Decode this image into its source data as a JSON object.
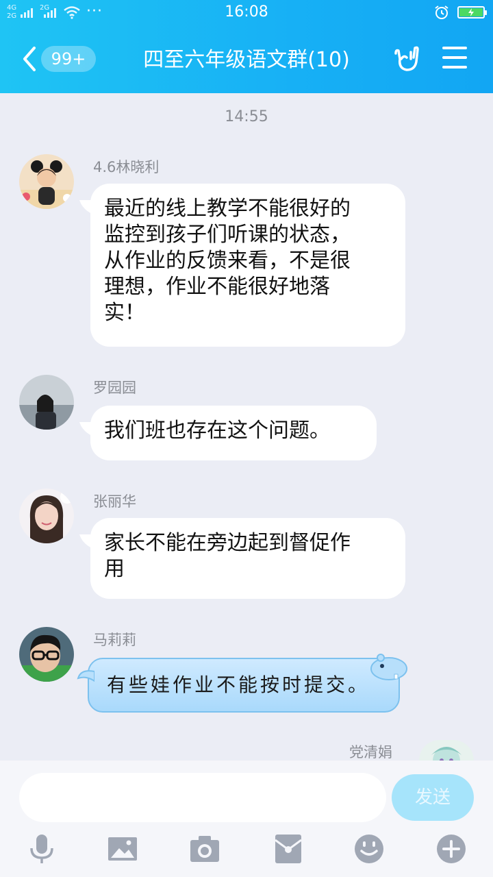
{
  "status_bar": {
    "network_a": "4G",
    "network_b": "2G",
    "network_c": "2G",
    "dots": "···",
    "time": "16:08",
    "alarm_icon": "alarm-clock-icon",
    "battery_icon": "battery-charging-icon"
  },
  "header": {
    "back_icon": "chevron-left-icon",
    "unread_badge": "99+",
    "title": "四至六年级语文群(10)",
    "gesture_icon": "hand-gesture-icon",
    "menu_icon": "hamburger-menu-icon",
    "colors": {
      "gradient_start": "#1fc4f4",
      "gradient_end": "#12a6f3"
    }
  },
  "chat": {
    "timestamp": "14:55",
    "messages": [
      {
        "sender": "4.6林晓利",
        "lines": [
          "最近的线上教学不能很好的",
          "监控到孩子们听课的状态，",
          "从作业的反馈来看，不是很",
          "理想，作业不能很好地落",
          "实！"
        ]
      },
      {
        "sender": "罗园园",
        "lines": [
          "我们班也存在这个问题。"
        ]
      },
      {
        "sender": "张丽华",
        "lines": [
          "家长不能在旁边起到督促作",
          "用"
        ]
      },
      {
        "sender": "马莉莉",
        "lines": [
          "有些娃作业不能按时提交。"
        ]
      },
      {
        "sender": "党清娟",
        "lines": []
      }
    ]
  },
  "input_bar": {
    "placeholder": "",
    "send_label": "发送",
    "tools": [
      "microphone-icon",
      "image-icon",
      "camera-icon",
      "red-packet-icon",
      "emoji-icon",
      "plus-icon"
    ]
  }
}
